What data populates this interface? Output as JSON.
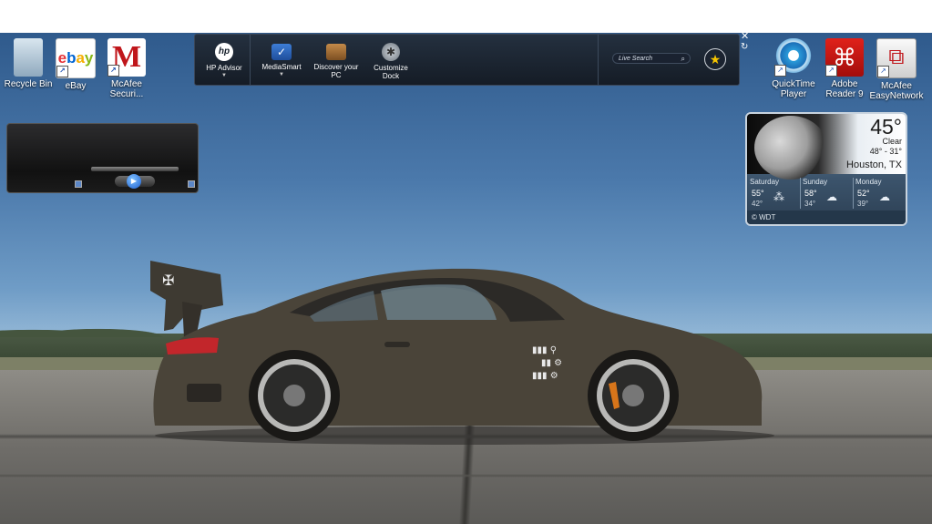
{
  "desktop_icons_left": [
    {
      "label": "Recycle Bin",
      "icon": "recycle-bin-icon"
    },
    {
      "label": "eBay",
      "icon": "ebay-icon"
    },
    {
      "label": "McAfee Securi...",
      "icon": "mcafee-icon"
    }
  ],
  "desktop_icons_right": [
    {
      "label": "QuickTime Player",
      "icon": "quicktime-icon"
    },
    {
      "label": "Adobe Reader 9",
      "icon": "adobe-reader-icon"
    },
    {
      "label": "McAfee EasyNetwork",
      "icon": "mcafee-easynetwork-icon"
    }
  ],
  "dock": {
    "items": [
      {
        "label": "HP Advisor",
        "icon": "hp-logo-icon"
      },
      {
        "label": "MediaSmart",
        "icon": "mediasmart-icon"
      },
      {
        "label": "Discover your PC",
        "icon": "discover-pc-icon"
      },
      {
        "label": "Customize Dock",
        "icon": "customize-dock-icon"
      }
    ],
    "search_placeholder": "Live Search",
    "hp_logo_text": "hp"
  },
  "weather": {
    "temperature": "45°",
    "condition": "Clear",
    "hi_lo": "48° - 31°",
    "city": "Houston, TX",
    "forecast": [
      {
        "day": "Saturday",
        "hi": "55°",
        "lo": "42°",
        "icon": "rain-icon"
      },
      {
        "day": "Sunday",
        "hi": "58°",
        "lo": "34°",
        "icon": "cloud-icon"
      },
      {
        "day": "Monday",
        "hi": "52°",
        "lo": "39°",
        "icon": "cloud-icon"
      }
    ],
    "provider": "© WDT"
  },
  "colors": {
    "dock_bg": "#151c26",
    "sky": "#4b79ab",
    "car_body": "#4a4439",
    "tail_light": "#c2262b"
  }
}
